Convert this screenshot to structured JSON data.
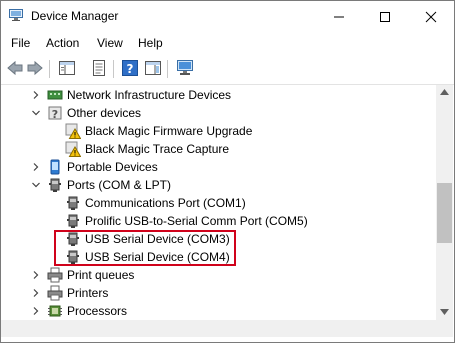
{
  "window": {
    "title": "Device Manager"
  },
  "menu": [
    "File",
    "Action",
    "View",
    "Help"
  ],
  "tree": {
    "items": [
      {
        "label": "Network Infrastructure Devices",
        "icon": "network-icon",
        "expander": "collapsed"
      },
      {
        "label": "Other devices",
        "icon": "unknown-device-icon",
        "expander": "expanded"
      },
      {
        "label": "Black Magic Firmware Upgrade",
        "icon": "warning-device-icon",
        "expander": "none"
      },
      {
        "label": "Black Magic Trace Capture",
        "icon": "warning-device-icon",
        "expander": "none"
      },
      {
        "label": "Portable Devices",
        "icon": "portable-device-icon",
        "expander": "collapsed"
      },
      {
        "label": "Ports (COM & LPT)",
        "icon": "port-icon",
        "expander": "expanded"
      },
      {
        "label": "Communications Port (COM1)",
        "icon": "port-icon",
        "expander": "none"
      },
      {
        "label": "Prolific USB-to-Serial Comm Port (COM5)",
        "icon": "port-icon",
        "expander": "none"
      },
      {
        "label": "USB Serial Device (COM3)",
        "icon": "port-icon",
        "expander": "none"
      },
      {
        "label": "USB Serial Device (COM4)",
        "icon": "port-icon",
        "expander": "none"
      },
      {
        "label": "Print queues",
        "icon": "printer-icon",
        "expander": "collapsed"
      },
      {
        "label": "Printers",
        "icon": "printer-icon",
        "expander": "collapsed"
      },
      {
        "label": "Processors",
        "icon": "processor-icon",
        "expander": "collapsed"
      }
    ]
  },
  "colors": {
    "highlight": "#d0021b",
    "warning": "#f4c20d",
    "accent": "#1e6fc7"
  }
}
